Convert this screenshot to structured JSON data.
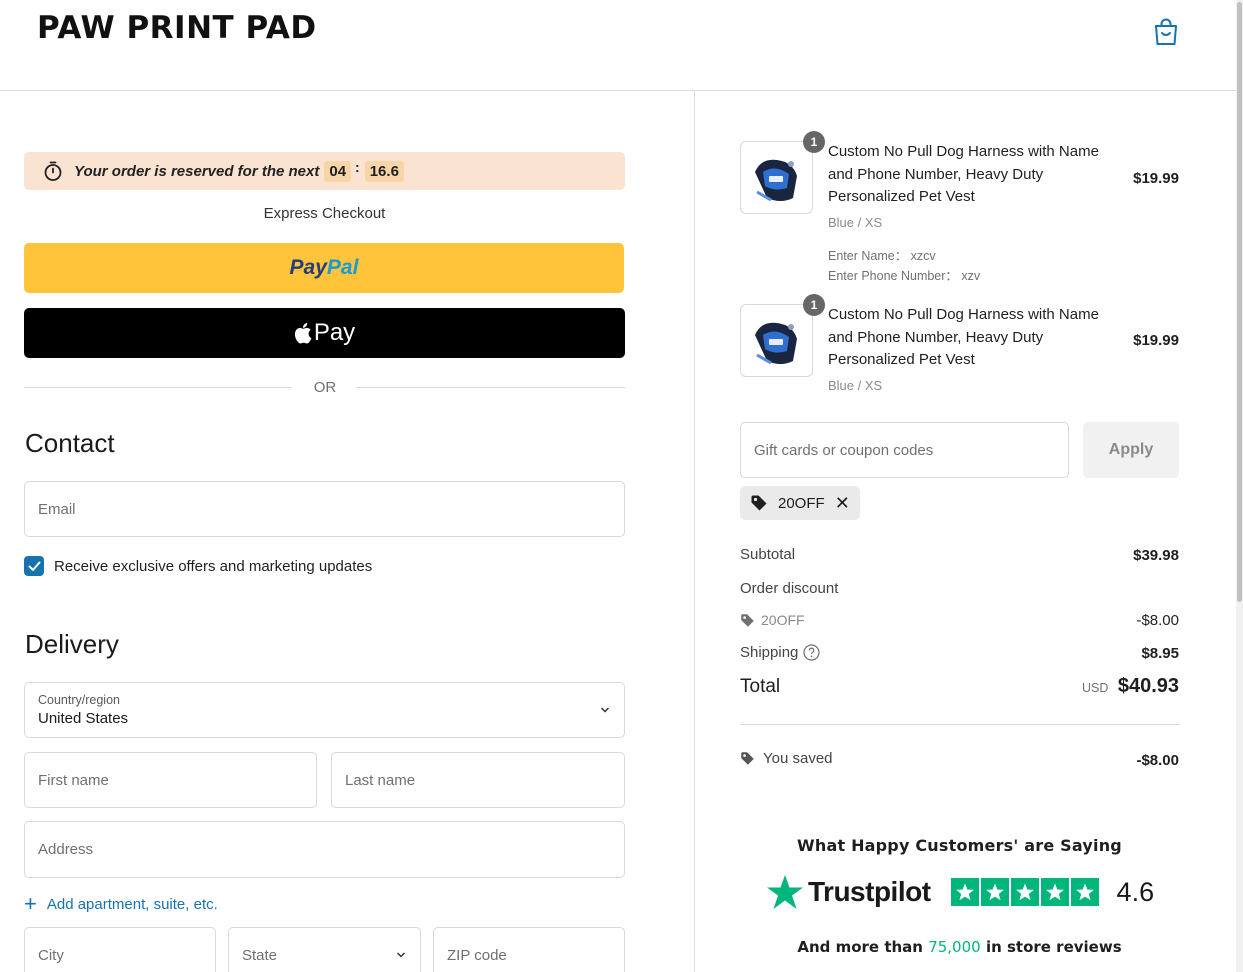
{
  "brand": "PAW PRINT PAD",
  "timer": {
    "text": "Your order is reserved for the next",
    "minutes": "04",
    "separator": ":",
    "seconds": "16.6"
  },
  "express": {
    "heading": "Express Checkout",
    "paypal_part1": "Pay",
    "paypal_part2": "Pal",
    "applepay_label": "Pay",
    "or_label": "OR"
  },
  "contact": {
    "title": "Contact",
    "email_placeholder": "Email",
    "marketing_label": "Receive exclusive offers and marketing updates",
    "marketing_checked": true
  },
  "delivery": {
    "title": "Delivery",
    "country_label": "Country/region",
    "country_value": "United States",
    "first_name_placeholder": "First name",
    "last_name_placeholder": "Last name",
    "address_placeholder": "Address",
    "add_apartment": "Add apartment, suite, etc.",
    "city_placeholder": "City",
    "state_placeholder": "State",
    "zip_placeholder": "ZIP code"
  },
  "cart": {
    "items": [
      {
        "qty": "1",
        "title": "Custom No Pull Dog Harness with Name and Phone Number, Heavy Duty Personalized Pet Vest",
        "variant": "Blue / XS",
        "prop_name": "Enter Name： xzcv",
        "prop_phone": "Enter Phone Number： xzv",
        "price": "$19.99"
      },
      {
        "qty": "1",
        "title": "Custom No Pull Dog Harness with Name and Phone Number, Heavy Duty Personalized Pet Vest",
        "variant": "Blue / XS",
        "price": "$19.99"
      }
    ]
  },
  "coupon": {
    "placeholder": "Gift cards or coupon codes",
    "apply_label": "Apply",
    "applied_code": "20OFF"
  },
  "summary": {
    "subtotal_label": "Subtotal",
    "subtotal_value": "$39.98",
    "order_discount_label": "Order discount",
    "discount_code": "20OFF",
    "discount_value": "-$8.00",
    "shipping_label": "Shipping",
    "shipping_value": "$8.95",
    "total_label": "Total",
    "total_currency": "USD",
    "total_value": "$40.93",
    "saved_label": "You saved",
    "saved_value": "-$8.00"
  },
  "reviews": {
    "heading": "What Happy Customers' are Saying",
    "trustpilot": "Trustpilot",
    "score": "4.6",
    "stars": 5,
    "foot_prefix": "And more than",
    "foot_number": "75,000",
    "foot_suffix": "in store reviews"
  },
  "colors": {
    "accent": "#1773b0",
    "paypal_yellow": "#ffc439",
    "timer_bg": "#fbe3d2",
    "trustpilot_green": "#00b67a"
  }
}
